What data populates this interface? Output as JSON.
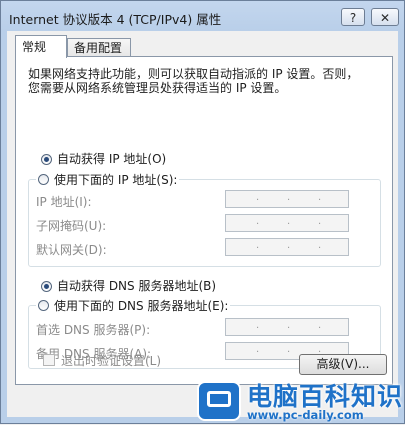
{
  "window": {
    "title": "Internet 协议版本 4 (TCP/IPv4) 属性",
    "help_label": "?",
    "close_label": "✕"
  },
  "tabs": [
    {
      "label": "常规",
      "active": true
    },
    {
      "label": "备用配置",
      "active": false
    }
  ],
  "description": "如果网络支持此功能，则可以获取自动指派的 IP 设置。否则，\n您需要从网络系统管理员处获得适当的 IP 设置。",
  "ip": {
    "auto_label": "自动获得 IP 地址(O)",
    "auto_selected": true,
    "manual_label": "使用下面的 IP 地址(S):",
    "manual_selected": false,
    "fields": [
      {
        "label": "IP 地址(I):",
        "value": ". . ."
      },
      {
        "label": "子网掩码(U):",
        "value": ". . ."
      },
      {
        "label": "默认网关(D):",
        "value": ". . ."
      }
    ]
  },
  "dns": {
    "auto_label": "自动获得 DNS 服务器地址(B)",
    "auto_selected": true,
    "manual_label": "使用下面的 DNS 服务器地址(E):",
    "manual_selected": false,
    "fields": [
      {
        "label": "首选 DNS 服务器(P):",
        "value": ". . ."
      },
      {
        "label": "备用 DNS 服务器(A):",
        "value": ". . ."
      }
    ]
  },
  "validate": {
    "label": "退出时验证设置(L)",
    "checked": false
  },
  "advanced_label": "高级(V)...",
  "watermark": {
    "title": "电脑百科知识",
    "url": "www.pc-daily.com"
  }
}
